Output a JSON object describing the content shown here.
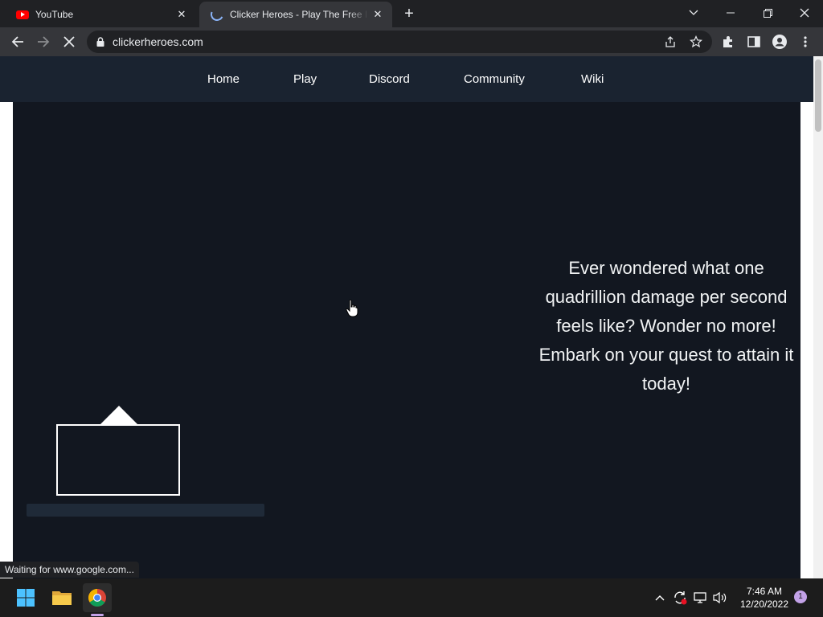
{
  "browser": {
    "tabs": [
      {
        "title": "YouTube",
        "icon": "youtube-icon",
        "active": false
      },
      {
        "title": "Clicker Heroes - Play The Free Idle Game",
        "icon": "loading-spinner-icon",
        "active": true
      }
    ],
    "url": "clickerheroes.com",
    "status_text": "Waiting for www.google.com..."
  },
  "site": {
    "nav": [
      "Home",
      "Play",
      "Discord",
      "Community",
      "Wiki"
    ],
    "tagline": "Ever wondered what one quadrillion damage per second feels like? Wonder no more! Embark on your quest to attain it today!",
    "colors": {
      "nav_bg": "#1a2330",
      "hero_bg": "#121720"
    }
  },
  "taskbar": {
    "time": "7:46 AM",
    "date": "12/20/2022",
    "notification_count": "1"
  }
}
